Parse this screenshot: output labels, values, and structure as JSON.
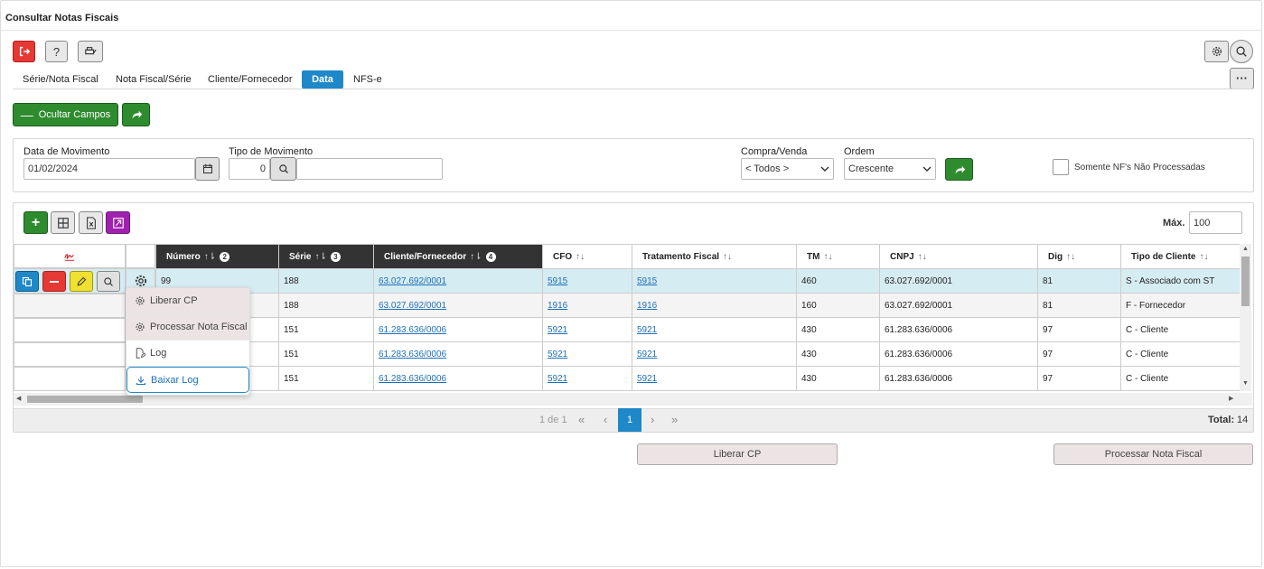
{
  "header": {
    "title": "Consultar Notas Fiscais"
  },
  "tabs": [
    "Série/Nota Fiscal",
    "Nota Fiscal/Série",
    "Cliente/Fornecedor",
    "Data",
    "NFS-e"
  ],
  "actions": {
    "hide_fields": "Ocultar Campos"
  },
  "filters": {
    "data_movimento_label": "Data de Movimento",
    "data_movimento_value": "01/02/2024",
    "tipo_movimento_label": "Tipo de Movimento",
    "tipo_movimento_value": "0",
    "compra_venda_label": "Compra/Venda",
    "compra_venda_value": "< Todos >",
    "ordem_label": "Ordem",
    "ordem_value": "Crescente",
    "checkbox_label": "Somente NF's Não Processadas"
  },
  "grid": {
    "max_label": "Máx.",
    "max_value": "100",
    "columns": [
      "Número",
      "Série",
      "Cliente/Fornecedor",
      "CFO",
      "Tratamento Fiscal",
      "TM",
      "CNPJ",
      "Dig",
      "Tipo de Cliente"
    ],
    "sort_badges": [
      "2",
      "3",
      "4"
    ],
    "rows": [
      {
        "numero": "99",
        "serie": "188",
        "cliente": "63.027.692/0001",
        "cfo": "5915",
        "trat": "5915",
        "tm": "460",
        "cnpj": "63.027.692/0001",
        "dig": "81",
        "tipo": "S - Associado com ST"
      },
      {
        "numero": "",
        "serie": "188",
        "cliente": "63.027.692/0001",
        "cfo": "1916",
        "trat": "1916",
        "tm": "160",
        "cnpj": "63.027.692/0001",
        "dig": "81",
        "tipo": "F - Fornecedor"
      },
      {
        "numero": "",
        "serie": "151",
        "cliente": "61.283.636/0006",
        "cfo": "5921",
        "trat": "5921",
        "tm": "430",
        "cnpj": "61.283.636/0006",
        "dig": "97",
        "tipo": "C - Cliente"
      },
      {
        "numero": "",
        "serie": "151",
        "cliente": "61.283.636/0006",
        "cfo": "5921",
        "trat": "5921",
        "tm": "430",
        "cnpj": "61.283.636/0006",
        "dig": "97",
        "tipo": "C - Cliente"
      },
      {
        "numero": "",
        "serie": "151",
        "cliente": "61.283.636/0006",
        "cfo": "5921",
        "trat": "5921",
        "tm": "430",
        "cnpj": "61.283.636/0006",
        "dig": "97",
        "tipo": "C - Cliente"
      }
    ],
    "context_menu": [
      "Liberar CP",
      "Processar Nota Fiscal",
      "Log",
      "Baixar Log"
    ],
    "pagination": {
      "info": "1 de 1",
      "current": "1",
      "first": "«",
      "prev": "‹",
      "next": "›",
      "last": "»"
    },
    "total_label": "Total:",
    "total_value": "14"
  },
  "bottom_buttons": {
    "liberar": "Liberar CP",
    "processar": "Processar Nota Fiscal"
  },
  "colors": {
    "accent": "#1e88c8",
    "green": "#2e8b2e",
    "red": "#e53935",
    "header_dark": "#333333",
    "selected_row": "#d6ecf3"
  }
}
